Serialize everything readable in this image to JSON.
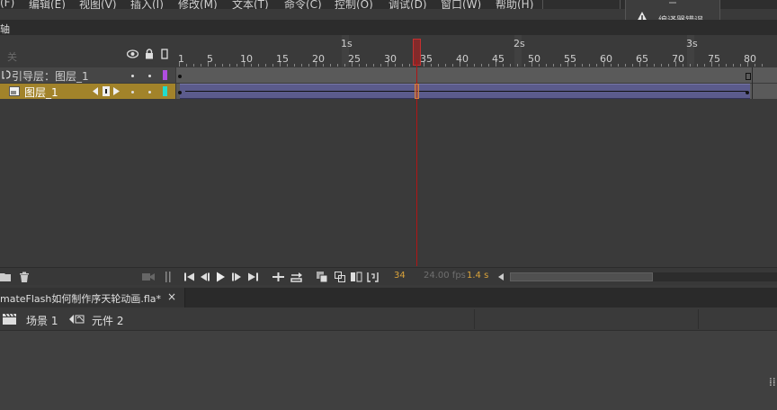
{
  "menu": {
    "items": [
      "(F)",
      "编辑(E)",
      "视图(V)",
      "插入(I)",
      "修改(M)",
      "文本(T)",
      "命令(C)",
      "控制(O)",
      "调试(D)",
      "窗口(W)",
      "帮助(H)"
    ]
  },
  "error_popup": {
    "label": "编译器错误",
    "icon": "warning-icon"
  },
  "timeline": {
    "tab_label": "轴",
    "header": {
      "off_label": "关",
      "icons": [
        "eye-icon",
        "lock-icon",
        "outline-icon"
      ]
    },
    "ruler": {
      "frame_labels": [
        "1",
        "5",
        "10",
        "15",
        "20",
        "25",
        "30",
        "35",
        "40",
        "45",
        "50",
        "55",
        "60",
        "65",
        "70",
        "75",
        "80"
      ],
      "second_labels": [
        "1s",
        "2s",
        "3s"
      ]
    },
    "layers": [
      {
        "name": "引导层：图层_1",
        "type": "guide",
        "color": "#b04ee0"
      },
      {
        "name": "图层_1",
        "type": "normal",
        "color": "#21dccc",
        "selected": true
      }
    ],
    "current_frame": 34,
    "total_frames": 80
  },
  "footer": {
    "current_frame": "34",
    "fps": "24.00 fps",
    "seconds": "1.4 s"
  },
  "document": {
    "tab_label": "mateFlash如何制作序天轮动画.fla*",
    "close_label": "×"
  },
  "breadcrumb": {
    "scene": "场景 1",
    "symbol": "元件 2"
  },
  "stage": {
    "ellipsis": "⁞⁞"
  },
  "colors": {
    "accent": "#a2832a",
    "playhead": "#b01515",
    "tween": "#5b5b8c"
  }
}
